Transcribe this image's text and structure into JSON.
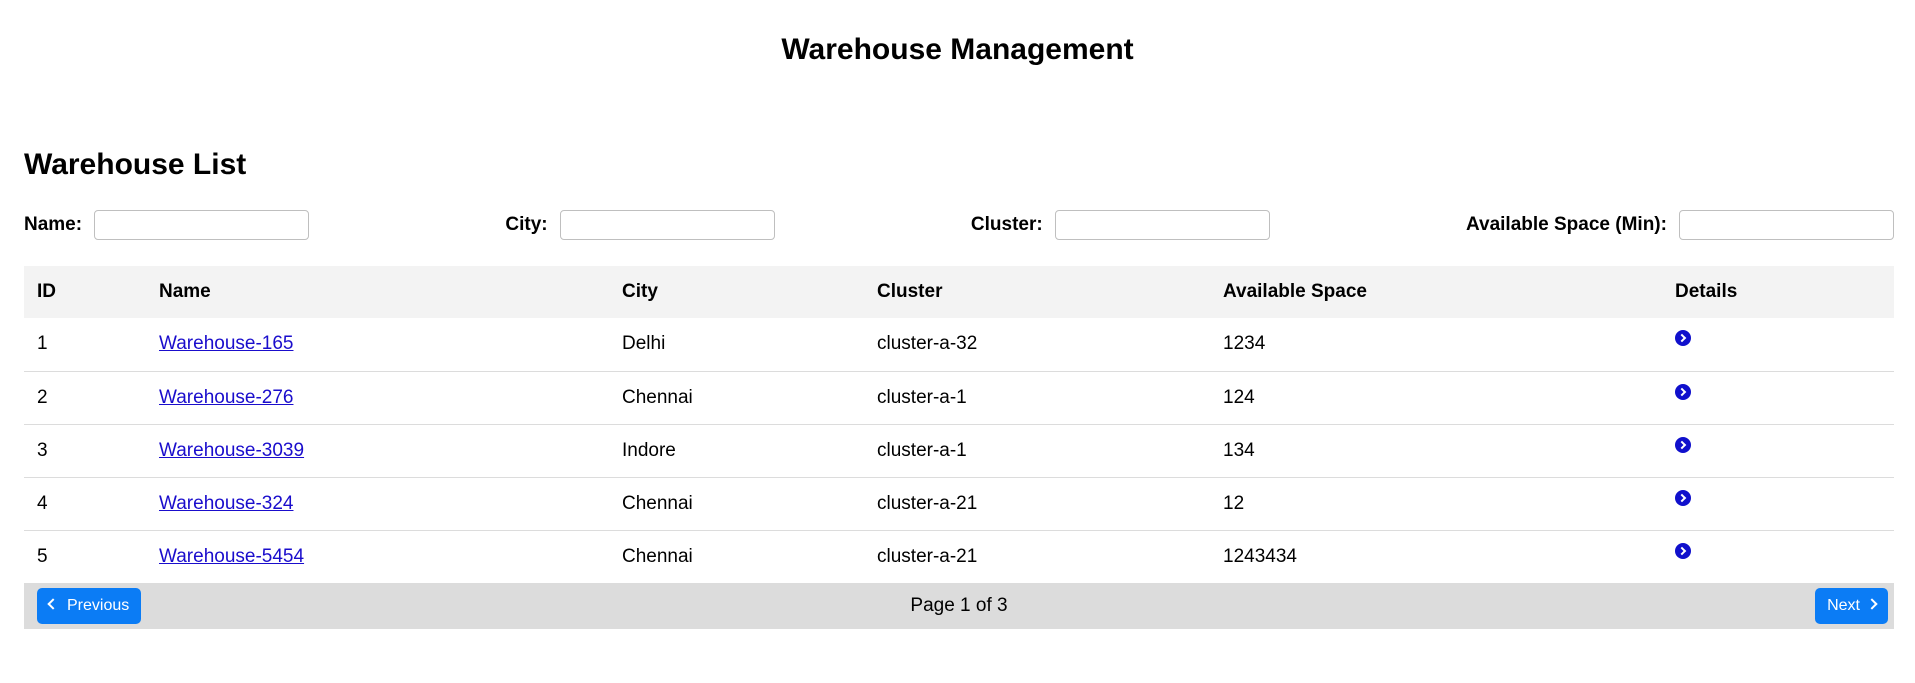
{
  "app": {
    "title": "Warehouse Management"
  },
  "list": {
    "title": "Warehouse List"
  },
  "filters": [
    {
      "label": "Name:",
      "value": "",
      "placeholder": ""
    },
    {
      "label": "City:",
      "value": "",
      "placeholder": ""
    },
    {
      "label": "Cluster:",
      "value": "",
      "placeholder": ""
    },
    {
      "label": "Available Space (Min):",
      "value": "",
      "placeholder": ""
    }
  ],
  "table": {
    "headers": [
      "ID",
      "Name",
      "City",
      "Cluster",
      "Available Space",
      "Details"
    ],
    "rows": [
      {
        "id": "1",
        "name": "Warehouse-165",
        "city": "Delhi",
        "cluster": "cluster-a-32",
        "space": "1234",
        "details_icon": "chevron-circle-right-icon"
      },
      {
        "id": "2",
        "name": "Warehouse-276",
        "city": "Chennai",
        "cluster": "cluster-a-1",
        "space": "124",
        "details_icon": "chevron-circle-right-icon"
      },
      {
        "id": "3",
        "name": "Warehouse-3039",
        "city": "Indore",
        "cluster": "cluster-a-1",
        "space": "134",
        "details_icon": "chevron-circle-right-icon"
      },
      {
        "id": "4",
        "name": "Warehouse-324",
        "city": "Chennai",
        "cluster": "cluster-a-21",
        "space": "12",
        "details_icon": "chevron-circle-right-icon"
      },
      {
        "id": "5",
        "name": "Warehouse-5454",
        "city": "Chennai",
        "cluster": "cluster-a-21",
        "space": "1243434",
        "details_icon": "chevron-circle-right-icon"
      }
    ]
  },
  "pagination": {
    "previous_label": "Previous",
    "next_label": "Next",
    "page_info": "Page 1 of 3",
    "current_page": 1,
    "total_pages": 3
  },
  "colors": {
    "primary_button": "#0b7cf5",
    "link": "#1a0dcc",
    "details_icon": "#1010cc",
    "header_bg": "#f3f3f3",
    "pager_bg": "#dcdcdc"
  }
}
